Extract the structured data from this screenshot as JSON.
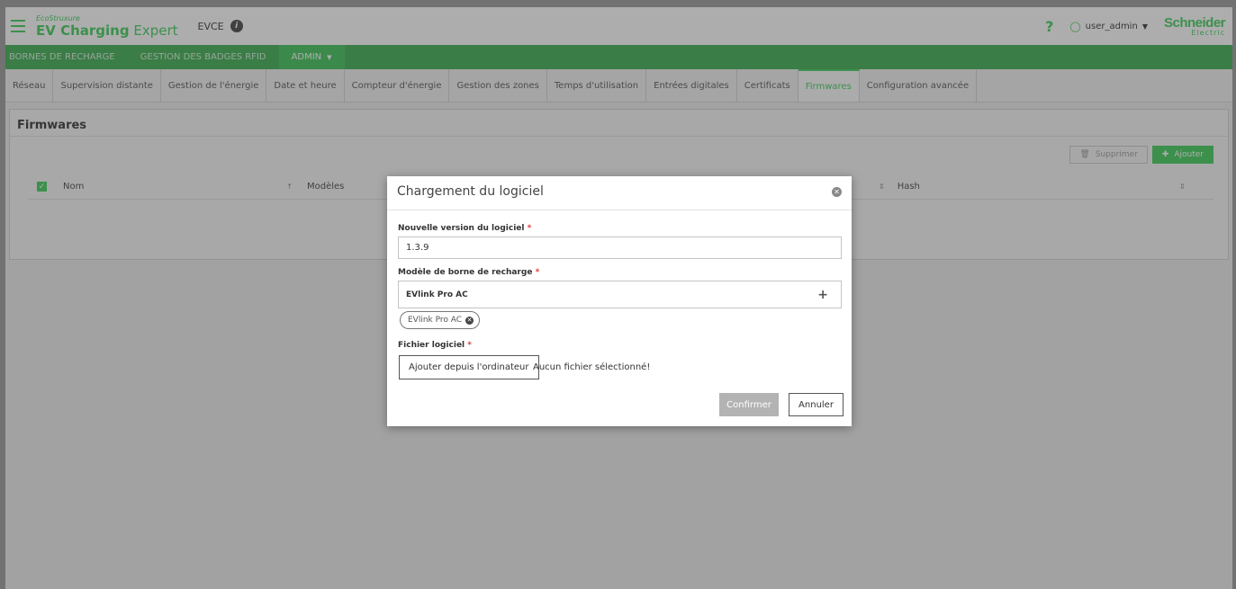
{
  "header": {
    "brand_eco": "EcoStruxure",
    "brand_product_bold": "EV Charging",
    "brand_product_light": " Expert",
    "site": "EVCE",
    "user": "user_admin",
    "logo_line1": "Schneider",
    "logo_line2": "Electric"
  },
  "mainnav": {
    "items": [
      {
        "label": "BORNES DE RECHARGE"
      },
      {
        "label": "GESTION DES BADGES RFID"
      },
      {
        "label": "ADMIN"
      }
    ]
  },
  "subnav": {
    "tabs": [
      {
        "label": "Réseau"
      },
      {
        "label": "Supervision distante"
      },
      {
        "label": "Gestion de l'énergie"
      },
      {
        "label": "Date et heure"
      },
      {
        "label": "Compteur d'énergie"
      },
      {
        "label": "Gestion des zones"
      },
      {
        "label": "Temps d'utilisation"
      },
      {
        "label": "Entrées digitales"
      },
      {
        "label": "Certificats"
      },
      {
        "label": "Firmwares"
      },
      {
        "label": "Configuration avancée"
      }
    ]
  },
  "panel": {
    "title": "Firmwares",
    "delete_label": "Supprimer",
    "add_label": "Ajouter",
    "columns": [
      {
        "label": "Nom"
      },
      {
        "label": "Modèles"
      },
      {
        "label": "Hash"
      }
    ]
  },
  "modal": {
    "title": "Chargement du logiciel",
    "version_label": "Nouvelle version du logiciel",
    "version_value": "1.3.9",
    "model_label": "Modèle de borne de recharge",
    "model_value": "EVlink Pro AC",
    "chip_label": "EVlink Pro AC",
    "file_label": "Fichier logiciel",
    "file_button": "Ajouter depuis l'ordinateur",
    "file_status": "Aucun fichier sélectionné!",
    "confirm": "Confirmer",
    "cancel": "Annuler",
    "required_mark": "*"
  }
}
